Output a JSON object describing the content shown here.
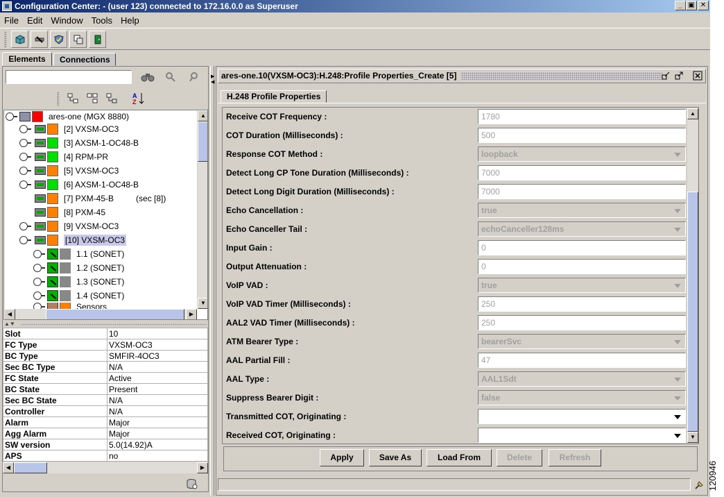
{
  "window": {
    "title": "Configuration Center: - (user 123) connected to 172.16.0.0 as Superuser",
    "min": "_",
    "max": "▣",
    "close": "✕"
  },
  "menus": [
    "File",
    "Edit",
    "Window",
    "Tools",
    "Help"
  ],
  "tabs": {
    "elements": "Elements",
    "connections": "Connections"
  },
  "search": {
    "value": ""
  },
  "tree": {
    "root": "ares-one (MGX 8880)",
    "items": [
      {
        "label": "[2] VXSM-OC3",
        "color": "#ff8000"
      },
      {
        "label": "[3] AXSM-1-OC48-B",
        "color": "#00e000"
      },
      {
        "label": "[4] RPM-PR",
        "color": "#00e000"
      },
      {
        "label": "[5] VXSM-OC3",
        "color": "#ff8000"
      },
      {
        "label": "[6] AXSM-1-OC48-B",
        "color": "#00e000"
      },
      {
        "label": "[7] PXM-45-B",
        "extra": "(sec [8])",
        "color": "#ff8000"
      },
      {
        "label": "[8] PXM-45",
        "color": "#ff8000"
      },
      {
        "label": "[9] VXSM-OC3",
        "color": "#ff8000"
      },
      {
        "label": "[10] VXSM-OC3",
        "color": "#ff8000"
      }
    ],
    "children": [
      "1.1  (SONET)",
      "1.2  (SONET)",
      "1.3  (SONET)",
      "1.4  (SONET)"
    ],
    "partial": "Sensors"
  },
  "properties": [
    {
      "k": "Slot",
      "v": "10"
    },
    {
      "k": "FC Type",
      "v": "VXSM-OC3"
    },
    {
      "k": "BC Type",
      "v": "SMFIR-4OC3"
    },
    {
      "k": "Sec BC Type",
      "v": "N/A"
    },
    {
      "k": "FC State",
      "v": "Active"
    },
    {
      "k": "BC State",
      "v": "Present"
    },
    {
      "k": "Sec BC State",
      "v": "N/A"
    },
    {
      "k": "Controller",
      "v": "N/A"
    },
    {
      "k": "Alarm",
      "v": "Major"
    },
    {
      "k": "Agg Alarm",
      "v": "Major"
    },
    {
      "k": "SW version",
      "v": "5.0(14.92)A"
    },
    {
      "k": "APS",
      "v": "no"
    }
  ],
  "panel": {
    "title": "ares-one.10(VXSM-OC3):H.248:Profile Properties_Create [5]",
    "subtab": "H.248 Profile Properties"
  },
  "form": [
    {
      "label": "Receive COT Frequency :",
      "value": "1780",
      "kind": "text"
    },
    {
      "label": "COT Duration (Milliseconds) :",
      "value": "500",
      "kind": "text"
    },
    {
      "label": "Response COT Method :",
      "value": "loopback",
      "kind": "combo"
    },
    {
      "label": "Detect Long CP Tone Duration (Milliseconds) :",
      "value": "7000",
      "kind": "text"
    },
    {
      "label": "Detect Long Digit Duration (Milliseconds) :",
      "value": "7000",
      "kind": "text"
    },
    {
      "label": "Echo Cancellation :",
      "value": "true",
      "kind": "combo"
    },
    {
      "label": "Echo Canceller Tail :",
      "value": "echoCanceller128ms",
      "kind": "combo"
    },
    {
      "label": "Input Gain :",
      "value": "0",
      "kind": "text"
    },
    {
      "label": "Output Attenuation :",
      "value": "0",
      "kind": "text"
    },
    {
      "label": "VoIP VAD :",
      "value": "true",
      "kind": "combo"
    },
    {
      "label": "VoIP VAD Timer (Milliseconds) :",
      "value": "250",
      "kind": "text"
    },
    {
      "label": "AAL2 VAD Timer (Milliseconds) :",
      "value": "250",
      "kind": "text"
    },
    {
      "label": "ATM Bearer Type :",
      "value": "bearerSvc",
      "kind": "combo"
    },
    {
      "label": "AAL Partial Fill :",
      "value": "47",
      "kind": "text"
    },
    {
      "label": "AAL Type :",
      "value": "AAL1Sdt",
      "kind": "combo"
    },
    {
      "label": "Suppress Bearer Digit :",
      "value": "false",
      "kind": "combo"
    },
    {
      "label": "Transmitted COT, Originating :",
      "value": "",
      "kind": "combo-active"
    },
    {
      "label": "Received COT, Originating :",
      "value": "",
      "kind": "combo-active"
    }
  ],
  "buttons": {
    "apply": "Apply",
    "save_as": "Save As",
    "load_from": "Load From",
    "delete": "Delete",
    "refresh": "Refresh"
  },
  "figure_id": "120946"
}
